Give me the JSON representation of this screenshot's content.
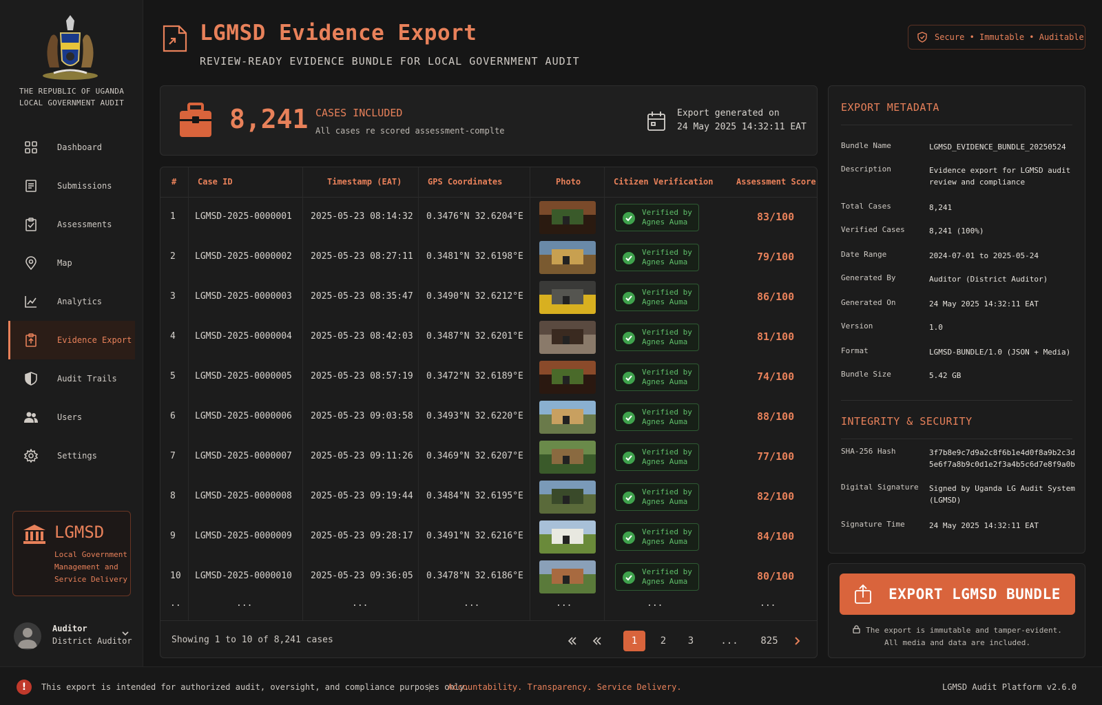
{
  "sidebar": {
    "republic_line1": "THE REPUBLIC OF UGANDA",
    "republic_line2": "LOCAL GOVERNMENT AUDIT",
    "nav": [
      {
        "label": "Dashboard",
        "icon": "grid-icon"
      },
      {
        "label": "Submissions",
        "icon": "document-icon"
      },
      {
        "label": "Assessments",
        "icon": "clipboard-check-icon"
      },
      {
        "label": "Map",
        "icon": "map-pin-icon"
      },
      {
        "label": "Analytics",
        "icon": "chart-line-icon"
      },
      {
        "label": "Evidence Export",
        "icon": "export-icon",
        "active": true
      },
      {
        "label": "Audit Trails",
        "icon": "shield-icon"
      },
      {
        "label": "Users",
        "icon": "users-icon"
      },
      {
        "label": "Settings",
        "icon": "gear-icon"
      }
    ],
    "brand": {
      "name": "LGMSD",
      "desc_line1": "Local Government",
      "desc_line2": "Management and",
      "desc_line3": "Service Delivery"
    },
    "user": {
      "name": "Auditor",
      "role": "District Auditor"
    }
  },
  "header": {
    "title": "LGMSD Evidence Export",
    "subtitle": "REVIEW-READY EVIDENCE BUNDLE FOR LOCAL GOVERNMENT AUDIT",
    "secure_badge": "Secure • Immutable • Auditable"
  },
  "summary": {
    "count": "8,241",
    "label": "CASES INCLUDED",
    "desc": "All cases re scored assessment-complte",
    "generated_line1": "Export generated on",
    "generated_line2": "24 May 2025 14:32:11 EAT"
  },
  "table": {
    "headers": [
      "#",
      "Case ID",
      "Timestamp (EAT)",
      "GPS Coordinates",
      "Photo",
      "Citizen Verification",
      "Assessment Score"
    ],
    "rows": [
      {
        "n": "1",
        "id": "LGMSD-2025-0000001",
        "ts": "2025-05-23 08:14:32",
        "gps": "0.3476°N 32.6204°E",
        "v1": "Verified by",
        "v2": "Agnes Auma",
        "score": "83/100"
      },
      {
        "n": "2",
        "id": "LGMSD-2025-0000002",
        "ts": "2025-05-23 08:27:11",
        "gps": "0.3481°N 32.6198°E",
        "v1": "Verified by",
        "v2": "Agnes Auma",
        "score": "79/100"
      },
      {
        "n": "3",
        "id": "LGMSD-2025-0000003",
        "ts": "2025-05-23 08:35:47",
        "gps": "0.3490°N 32.6212°E",
        "v1": "Verified by",
        "v2": "Agnes Auma",
        "score": "86/100"
      },
      {
        "n": "4",
        "id": "LGMSD-2025-0000004",
        "ts": "2025-05-23 08:42:03",
        "gps": "0.3487°N 32.6201°E",
        "v1": "Verified by",
        "v2": "Agnes Auma",
        "score": "81/100"
      },
      {
        "n": "5",
        "id": "LGMSD-2025-0000005",
        "ts": "2025-05-23 08:57:19",
        "gps": "0.3472°N 32.6189°E",
        "v1": "Verified by",
        "v2": "Agnes Auma",
        "score": "74/100"
      },
      {
        "n": "6",
        "id": "LGMSD-2025-0000006",
        "ts": "2025-05-23 09:03:58",
        "gps": "0.3493°N 32.6220°E",
        "v1": "Verified by",
        "v2": "Agnes Auma",
        "score": "88/100"
      },
      {
        "n": "7",
        "id": "LGMSD-2025-0000007",
        "ts": "2025-05-23 09:11:26",
        "gps": "0.3469°N 32.6207°E",
        "v1": "Verified by",
        "v2": "Agnes Auma",
        "score": "77/100"
      },
      {
        "n": "8",
        "id": "LGMSD-2025-0000008",
        "ts": "2025-05-23 09:19:44",
        "gps": "0.3484°N 32.6195°E",
        "v1": "Verified by",
        "v2": "Agnes Auma",
        "score": "82/100"
      },
      {
        "n": "9",
        "id": "LGMSD-2025-0000009",
        "ts": "2025-05-23 09:28:17",
        "gps": "0.3491°N 32.6216°E",
        "v1": "Verified by",
        "v2": "Agnes Auma",
        "score": "84/100"
      },
      {
        "n": "10",
        "id": "LGMSD-2025-0000010",
        "ts": "2025-05-23 09:36:05",
        "gps": "0.3478°N 32.6186°E",
        "v1": "Verified by",
        "v2": "Agnes Auma",
        "score": "80/100"
      }
    ],
    "ellipsis": "...",
    "dots": "..",
    "showing": "Showing 1 to 10 of 8,241 cases",
    "pages": [
      "1",
      "2",
      "3",
      "...",
      "825"
    ]
  },
  "metadata": {
    "title": "EXPORT METADATA",
    "rows": [
      {
        "k": "Bundle Name",
        "v": "LGMSD_EVIDENCE_BUNDLE_20250524"
      },
      {
        "k": "Description",
        "v": "Evidence export for LGMSD audit review and compliance"
      },
      {
        "k": "Total Cases",
        "v": "8,241"
      },
      {
        "k": "Verified Cases",
        "v": "8,241 (100%)"
      },
      {
        "k": "Date Range",
        "v": "2024-07-01 to 2025-05-24"
      },
      {
        "k": "Generated By",
        "v": "Auditor (District Auditor)"
      },
      {
        "k": "Generated On",
        "v": "24 May 2025 14:32:11 EAT"
      },
      {
        "k": "Version",
        "v": "1.0"
      },
      {
        "k": "Format",
        "v": "LGMSD-BUNDLE/1.0 (JSON + Media)"
      },
      {
        "k": "Bundle Size",
        "v": "5.42 GB"
      }
    ],
    "security_title": "INTEGRITY & SECURITY",
    "security": [
      {
        "k": "SHA-256 Hash",
        "v": "3f7b8e9c7d9a2c8f6b1e4d0f8a9b2c3d 5e6f7a8b9c0d1e2f3a4b5c6d7e8f9a0b"
      },
      {
        "k": "Digital Signature",
        "v": "Signed by Uganda LG Audit System (LGMSD)"
      },
      {
        "k": "Signature Time",
        "v": "24 May 2025 14:32:11 EAT"
      }
    ]
  },
  "export": {
    "button": "EXPORT LGMSD BUNDLE",
    "note_line1": "The export is immutable and tamper-evident.",
    "note_line2": "All media and data are included."
  },
  "footer": {
    "notice": "This export is intended for authorized audit, oversight, and compliance purposes only.",
    "sep": "|",
    "motto": "Accountability. Transparency. Service Delivery.",
    "version": "LGMSD Audit Platform v2.6.0"
  },
  "colors": {
    "accent": "#e8815a",
    "button": "#d9643c",
    "verified": "#3fa34d",
    "background": "#161616"
  }
}
